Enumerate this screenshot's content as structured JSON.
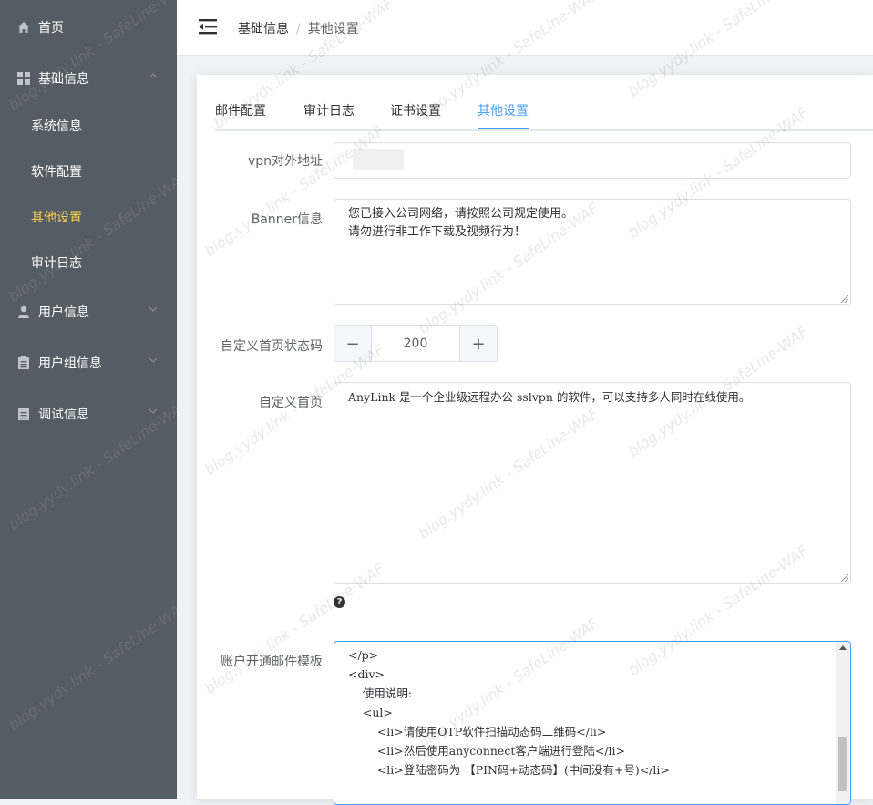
{
  "sidebar": {
    "home": "首页",
    "basic": "基础信息",
    "basic_items": [
      "系统信息",
      "软件配置",
      "其他设置",
      "审计日志"
    ],
    "user": "用户信息",
    "group": "用户组信息",
    "debug": "调试信息",
    "active_color": "#ffd04b",
    "bg_color": "#545c64"
  },
  "header": {
    "breadcrumb": [
      "基础信息",
      "其他设置"
    ],
    "breadcrumb_sep": "/"
  },
  "tabs": [
    "邮件配置",
    "审计日志",
    "证书设置",
    "其他设置"
  ],
  "active_tab": "其他设置",
  "form": {
    "vpn_label": "vpn对外地址",
    "banner_label": "Banner信息",
    "banner_value": "您已接入公司网络，请按照公司规定使用。\n请勿进行非工作下载及视频行为！",
    "status_code_label": "自定义首页状态码",
    "status_code_value": "200",
    "minus": "−",
    "plus": "+",
    "homepage_label": "自定义首页",
    "homepage_value": "AnyLink 是一个企业级远程办公 sslvpn 的软件，可以支持多人同时在线使用。",
    "help_icon": "?",
    "mail_label": "账户开通邮件模板",
    "mail_value": "</p>\n<div>\n    使用说明:\n    <ul>\n        <li>请使用OTP软件扫描动态码二维码</li>\n        <li>然后使用anyconnect客户端进行登陆</li>\n        <li>登陆密码为 【PIN码+动态码】(中间没有+号)</li>"
  },
  "watermark": "blog.yydy.link - SafeLine-WAF"
}
